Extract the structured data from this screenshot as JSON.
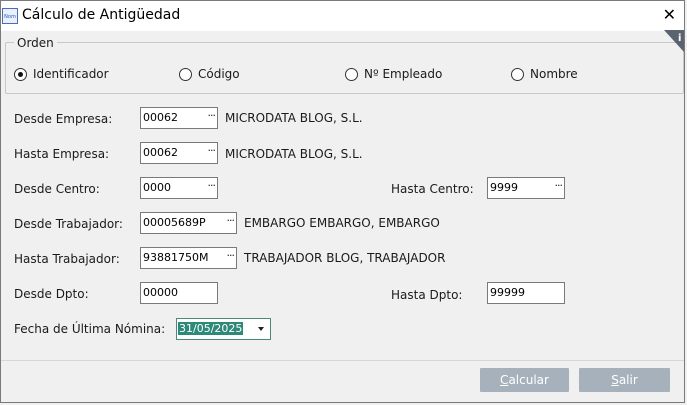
{
  "window": {
    "title": "Cálculo de Antigüedad",
    "app_icon_text": "Nom",
    "close_label": "✕"
  },
  "orden": {
    "legend": "Orden",
    "options": [
      {
        "label": "Identificador",
        "checked": true
      },
      {
        "label": "Código",
        "checked": false
      },
      {
        "label": "Nº Empleado",
        "checked": false
      },
      {
        "label": "Nombre",
        "checked": false
      }
    ],
    "info_icon": "info-icon"
  },
  "form": {
    "desde_empresa": {
      "label": "Desde Empresa:",
      "value": "00062",
      "desc": "MICRODATA BLOG, S.L."
    },
    "hasta_empresa": {
      "label": "Hasta Empresa:",
      "value": "00062",
      "desc": "MICRODATA BLOG, S.L."
    },
    "desde_centro": {
      "label": "Desde Centro:",
      "value": "0000"
    },
    "hasta_centro": {
      "label": "Hasta Centro:",
      "value": "9999"
    },
    "desde_trabajador": {
      "label": "Desde Trabajador:",
      "value": "00005689P",
      "desc": "EMBARGO EMBARGO, EMBARGO"
    },
    "hasta_trabajador": {
      "label": "Hasta Trabajador:",
      "value": "93881750M",
      "desc": "TRABAJADOR BLOG, TRABAJADOR"
    },
    "desde_dpto": {
      "label": "Desde Dpto:",
      "value": "00000"
    },
    "hasta_dpto": {
      "label": "Hasta Dpto:",
      "value": "99999"
    },
    "fecha": {
      "label": "Fecha de Última Nómina:",
      "value": "31/05/2025"
    },
    "lookup_glyph": "···"
  },
  "buttons": {
    "calcular": {
      "first": "C",
      "rest": "alcular"
    },
    "salir": {
      "first": "S",
      "rest": "alir"
    }
  },
  "colors": {
    "button_bg": "#a7b1bb",
    "date_highlight": "#2e8a78",
    "window_bg": "#f0f0f0"
  }
}
